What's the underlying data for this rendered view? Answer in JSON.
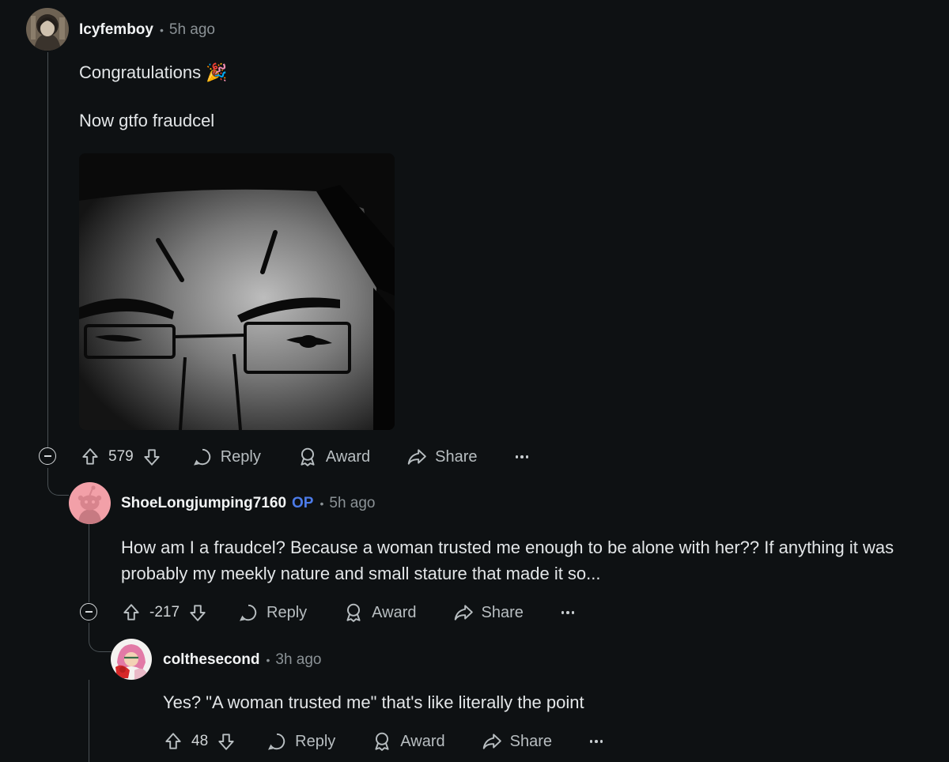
{
  "comments": [
    {
      "username": "Icyfemboy",
      "time": "5h ago",
      "paragraphs": [
        "Congratulations 🎉",
        "Now gtfo fraudcel"
      ],
      "score": "579",
      "actions": {
        "reply": "Reply",
        "award": "Award",
        "share": "Share"
      }
    },
    {
      "username": "ShoeLongjumping7160",
      "op_badge": "OP",
      "time": "5h ago",
      "paragraphs": [
        "How am I a fraudcel? Because a woman trusted me enough to be alone with her?? If anything it was probably my meekly nature and small stature that made it so..."
      ],
      "score": "-217",
      "actions": {
        "reply": "Reply",
        "award": "Award",
        "share": "Share"
      }
    },
    {
      "username": "colthesecond",
      "time": "3h ago",
      "paragraphs": [
        "Yes? \"A woman trusted me\" that's like literally the point"
      ],
      "score": "48",
      "actions": {
        "reply": "Reply",
        "award": "Award",
        "share": "Share"
      }
    }
  ],
  "colors": {
    "background": "#0e1113",
    "op_badge": "#4c7be8",
    "muted_text": "#8b9296"
  }
}
